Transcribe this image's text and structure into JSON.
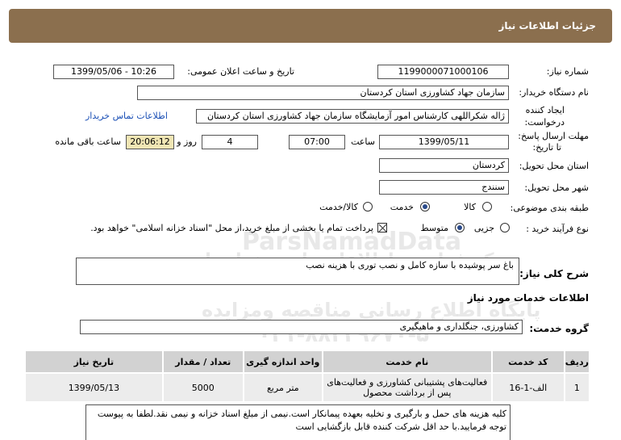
{
  "header": {
    "title": "جزئیات اطلاعات نیاز"
  },
  "fields": {
    "need_number_label": "شماره نیاز:",
    "need_number": "1199000071000106",
    "announce_label": "تاریخ و ساعت اعلان عمومی:",
    "announce_value": "1399/05/06 - 10:26",
    "buyer_label": "نام دستگاه خریدار:",
    "buyer_value": "سازمان جهاد کشاورزی استان کردستان",
    "creator_label_1": "ایجاد کننده",
    "creator_label_2": "درخواست:",
    "creator_value": "ژاله شکراللهی کارشناس امور آزمایشگاه سازمان جهاد کشاورزی استان کردستان",
    "contact_link": "اطلاعات تماس خریدار",
    "deadline_label_1": "مهلت ارسال پاسخ:",
    "deadline_label_2": "تا تاریخ:",
    "deadline_date": "1399/05/11",
    "time_label": "ساعت",
    "deadline_time": "07:00",
    "days_value": "4",
    "days_label": "روز و",
    "remaining_time": "20:06:12",
    "remaining_label": "ساعت باقی مانده",
    "province_label": "استان محل تحویل:",
    "province_value": "کردستان",
    "city_label": "شهر محل تحویل:",
    "city_value": "سنندج",
    "category_label": "طبقه بندی موضوعی:",
    "category_options": [
      "کالا",
      "خدمت",
      "کالا/خدمت"
    ],
    "category_selected": "خدمت",
    "process_label": "نوع فرآیند خرید :",
    "process_options": [
      "جزیی",
      "متوسط"
    ],
    "process_selected": "متوسط",
    "payment_note": "پرداخت تمام یا بخشی از مبلغ خرید،از محل \"اسناد خزانه اسلامی\" خواهد بود."
  },
  "summary": {
    "label": "شرح کلی نیاز:",
    "value": "باغ سر پوشیده با سازه کامل و نصب توری با هزینه نصب"
  },
  "services": {
    "title": "اطلاعات خدمات مورد نیاز",
    "group_label": "گروه خدمت:",
    "group_value": "کشاورزی، جنگلداری و ماهیگیری",
    "columns": [
      "ردیف",
      "کد خدمت",
      "نام خدمت",
      "واحد اندازه گیری",
      "تعداد / مقدار",
      "تاریخ نیاز"
    ],
    "rows": [
      [
        "1",
        "الف-1-16",
        "فعالیت‌های پشتیبانی کشاورزی و فعالیت‌های پس از برداشت محصول",
        "متر مربع",
        "5000",
        "1399/05/13"
      ]
    ]
  },
  "notes": "کلیه هزینه های حمل و بارگیری و تخلیه بعهده پیمانکار است.نیمی از مبلغ اسناد خزانه و نیمی نقد.لطفا به پیوست توجه فرمایید.با حد اقل شرکت کننده قابل بازگشایی است",
  "watermark": {
    "line1": "ParsNamadData",
    "line2": "مرکز فراوری اطلاعات پارس نماد داده",
    "line3": "پایگاه اطلاع رسانی مناقصه ومزایده",
    "line4": "۰۲۱-۸۸۳۴۹۶۷۰-۵"
  }
}
